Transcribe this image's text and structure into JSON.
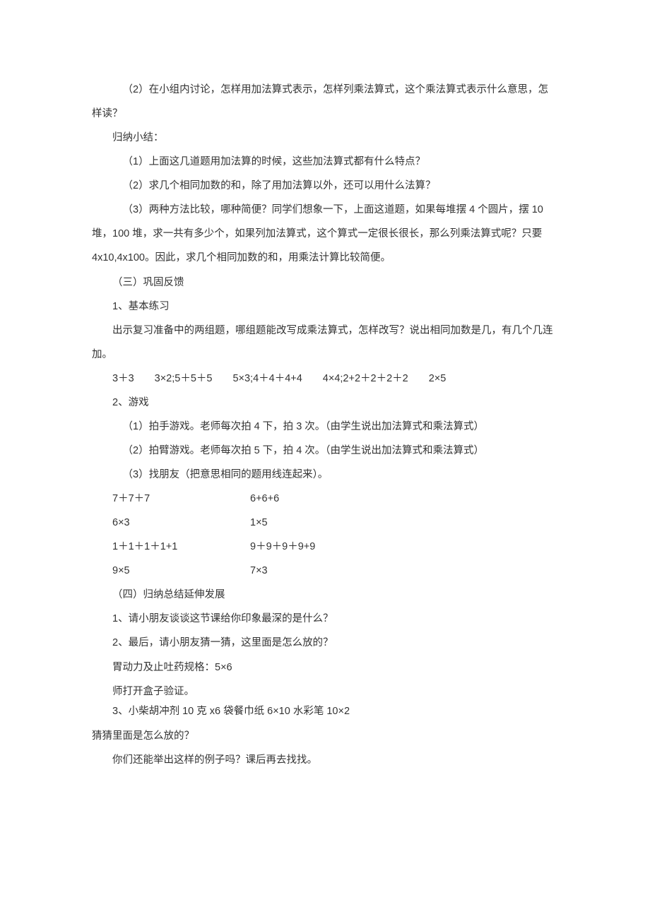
{
  "p1": "（2）在小组内讨论，怎样用加法算式表示，怎样列乘法算式，这个乘法算式表示什么意思，怎样读？",
  "p2": "归纳小结：",
  "p3": "（1）上面这几道题用加法算的时候，这些加法算式都有什么特点？",
  "p4": "（2）求几个相同加数的和，除了用加法算以外，还可以用什么法算？",
  "p5": "（3）两种方法比较，哪种简便？同学们想象一下，上面这道题，如果每堆摆 4 个圆片，摆 10 堆，100 堆，求一共有多少个，如果列加法算式，这个算式一定很长很长，那么列乘法算式呢？只要 4x10,4x100。因此，求几个相同加数的和，用乘法计算比较简便。",
  "p6": "（三）巩固反馈",
  "p7": "1、基本练习",
  "p8": "出示复习准备中的两组题，哪组题能改写成乘法算式，怎样改写？说出相同加数是几，有几个几连加。",
  "p9": "3＋3　　3×2;5＋5＋5　　5×3;4＋4＋4+4　　4×4;2+2＋2＋2＋2　　2×5",
  "p10": "2、游戏",
  "p11": "（1）拍手游戏。老师每次拍 4 下，拍 3 次。（由学生说出加法算式和乘法算式）",
  "p12": "（2）拍臂游戏。老师每次拍 5 下，拍 4 次。（由学生说出加法算式和乘法算式）",
  "p13": "（3）找朋友（把意思相同的题用线连起来）。",
  "r1a": "7＋7＋7",
  "r1b": "6+6+6",
  "r2a": "6×3",
  "r2b": "1×5",
  "r3a": "1＋1＋1＋1+1",
  "r3b": "9＋9＋9＋9+9",
  "r4a": "9×5",
  "r4b": "7×3",
  "p14": "（四）归纳总结延伸发展",
  "p15": "1、请小朋友谈谈这节课给你印象最深的是什么？",
  "p16": "2、最后，请小朋友猜一猜，这里面是怎么放的？",
  "p17": "胃动力及止吐药规格：5×6",
  "p18": "师打开盒子验证。",
  "p19": "3、小柴胡冲剂 10 克 x6 袋餐巾纸 6×10 水彩笔 10×2",
  "p19b": "猜猜里面是怎么放的？",
  "p20": "你们还能举出这样的例子吗？课后再去找找。"
}
